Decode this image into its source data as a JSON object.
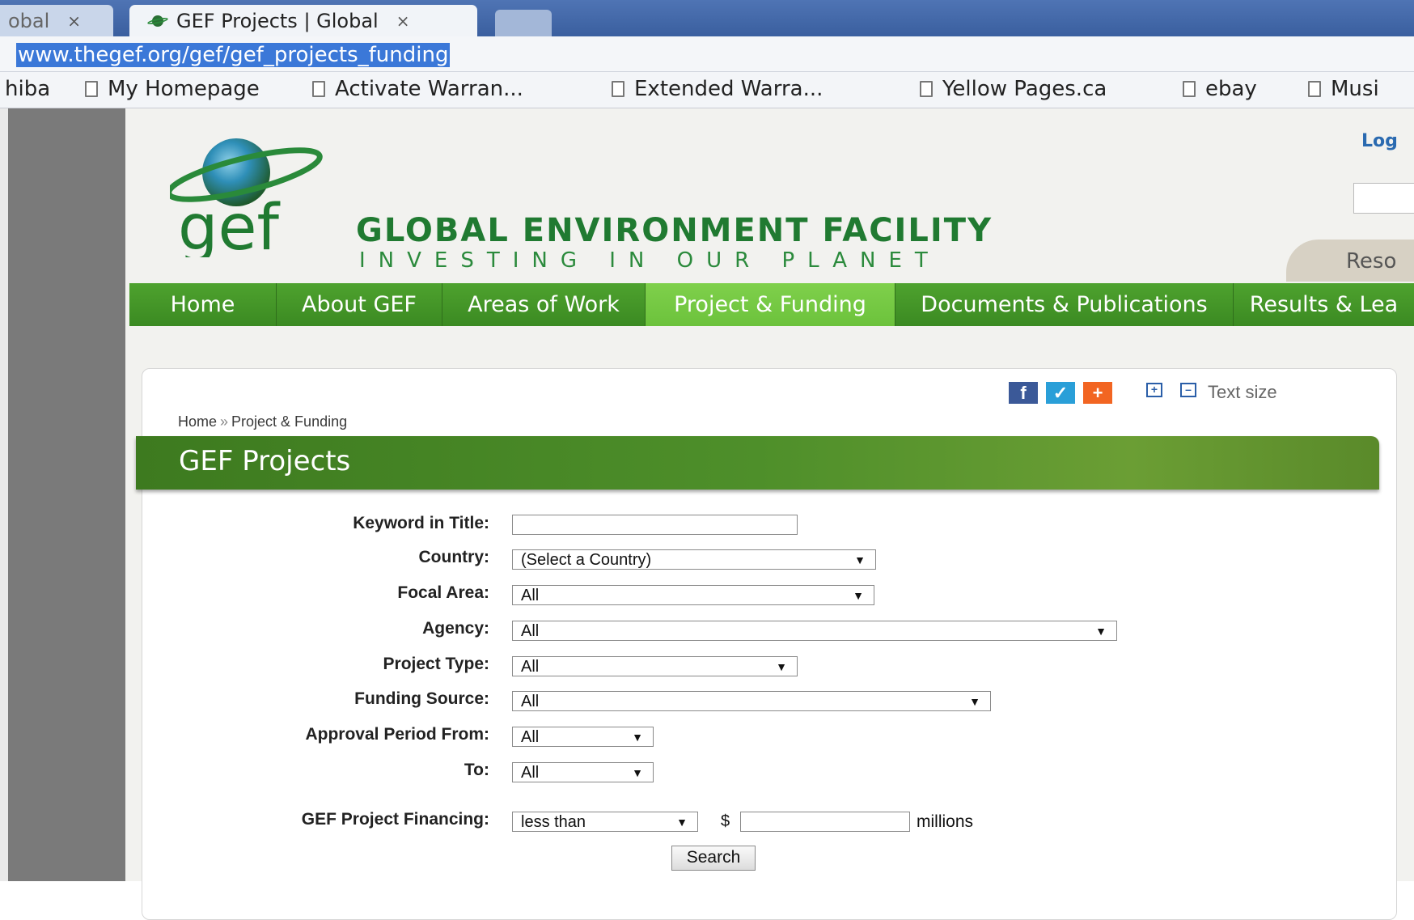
{
  "browser": {
    "tabs": [
      {
        "label": "obal",
        "close": "×"
      },
      {
        "label": "GEF Projects | Global",
        "close": "×"
      }
    ],
    "url": "www.thegef.org/gef/gef_projects_funding",
    "bookmarks": [
      "hiba",
      "My Homepage",
      "Activate Warran...",
      "Extended Warra...",
      "Yellow Pages.ca",
      "ebay",
      "Musi"
    ]
  },
  "header": {
    "logo_text": "gef",
    "site_name": "GLOBAL ENVIRONMENT FACILITY",
    "tagline": "INVESTING IN OUR PLANET",
    "login_label": "Log",
    "resources_tab": "Reso"
  },
  "nav": {
    "items": [
      "Home",
      "About GEF",
      "Areas of Work",
      "Project & Funding",
      "Documents & Publications",
      "Results & Lea"
    ],
    "active": "Project & Funding"
  },
  "toolbar": {
    "text_size_label": "Text size",
    "share_icons": [
      "facebook-icon",
      "twitter-icon",
      "addthis-icon"
    ]
  },
  "breadcrumb": {
    "home": "Home",
    "sep": "»",
    "current": "Project & Funding"
  },
  "page_title": "GEF Projects",
  "form": {
    "keyword_label": "Keyword in Title:",
    "keyword_value": "",
    "country_label": "Country:",
    "country_value": "(Select a Country)",
    "focal_label": "Focal Area:",
    "focal_value": "All",
    "agency_label": "Agency:",
    "agency_value": "All",
    "type_label": "Project Type:",
    "type_value": "All",
    "funding_label": "Funding Source:",
    "funding_value": "All",
    "from_label": "Approval Period From:",
    "from_value": "All",
    "to_label": "To:",
    "to_value": "All",
    "financing_label": "GEF Project Financing:",
    "financing_op": "less than",
    "currency": "$",
    "amount_value": "",
    "units": "millions",
    "search_label": "Search"
  },
  "colors": {
    "nav_green": "#3b8a22",
    "nav_active": "#6cc23c",
    "brand_green": "#207a31",
    "url_highlight": "#3b78d8"
  }
}
